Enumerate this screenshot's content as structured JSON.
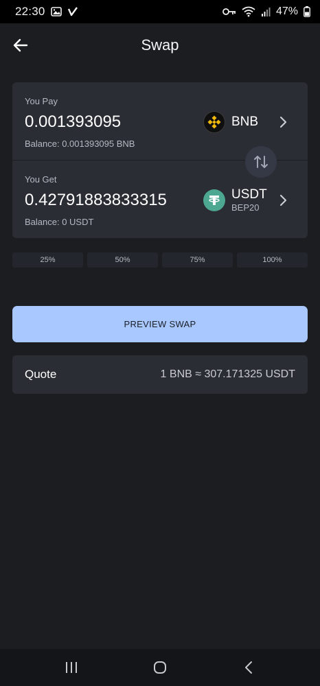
{
  "status_bar": {
    "time": "22:30",
    "battery": "47%"
  },
  "header": {
    "title": "Swap"
  },
  "pay": {
    "label": "You Pay",
    "amount": "0.001393095",
    "balance": "Balance: 0.001393095 BNB",
    "token_symbol": "BNB",
    "token_icon": "bnb-logo-icon"
  },
  "get": {
    "label": "You Get",
    "amount": "0.42791883833315",
    "balance": "Balance: 0 USDT",
    "token_symbol": "USDT",
    "token_network": "BEP20",
    "token_icon": "usdt-logo-icon"
  },
  "percent_buttons": [
    "25%",
    "50%",
    "75%",
    "100%"
  ],
  "preview_button": "PREVIEW SWAP",
  "quote": {
    "label": "Quote",
    "value": "1 BNB ≈ 307.171325 USDT"
  },
  "colors": {
    "background": "#1c1d20",
    "card": "#2a2d34",
    "accent": "#a9c8ff",
    "usdt": "#4da892",
    "bnb": "#f0b90b"
  }
}
